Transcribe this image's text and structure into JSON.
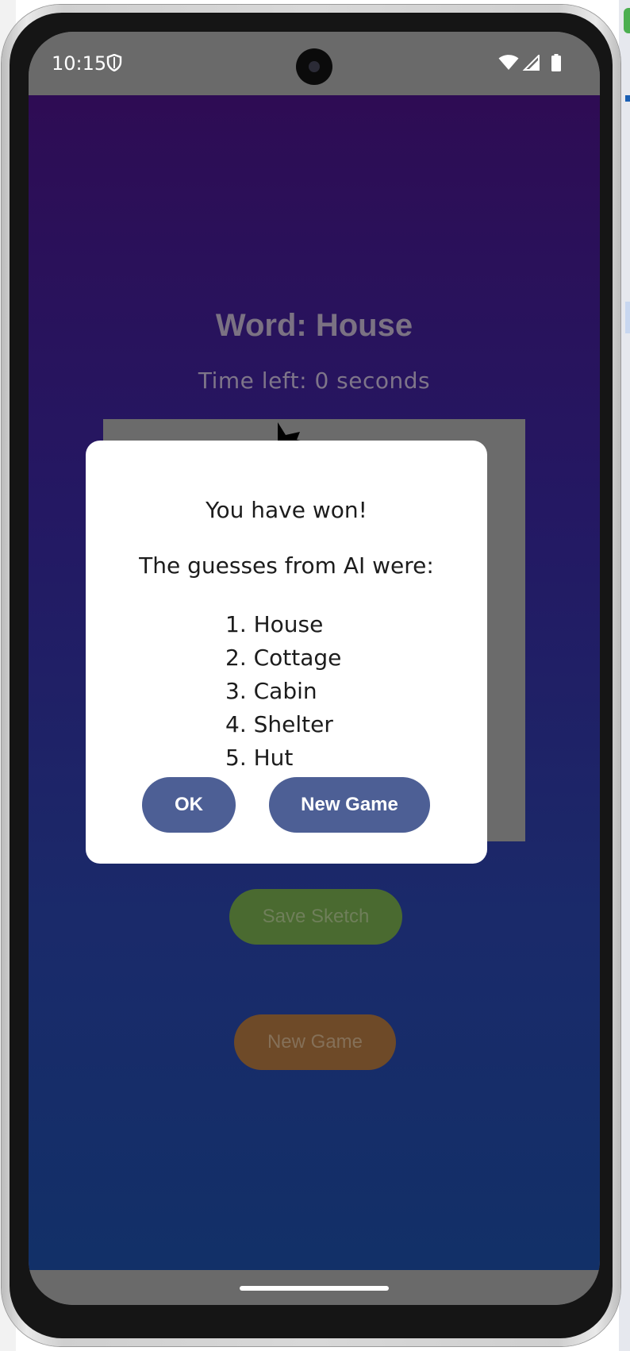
{
  "status_bar": {
    "time": "10:15",
    "icons": [
      "shield-icon",
      "wifi-icon",
      "signal-icon",
      "battery-icon"
    ]
  },
  "game": {
    "word_title": "Word: House",
    "time_left": "Time left: 0 seconds",
    "save_button_label": "Save Sketch",
    "new_game_button_label": "New Game"
  },
  "dialog": {
    "title": "You have won!",
    "subtitle": "The guesses from AI were:",
    "guesses": [
      "1. House",
      "2. Cottage",
      "3. Cabin",
      "4. Shelter",
      "5. Hut"
    ],
    "ok_label": "OK",
    "new_game_label": "New Game"
  },
  "colors": {
    "dialog_button": "#4d5f95",
    "save_button": "#4a6a30",
    "new_game_background_button": "#6e4a28",
    "app_gradient_top": "#2e0c54",
    "app_gradient_bottom": "#123068"
  }
}
